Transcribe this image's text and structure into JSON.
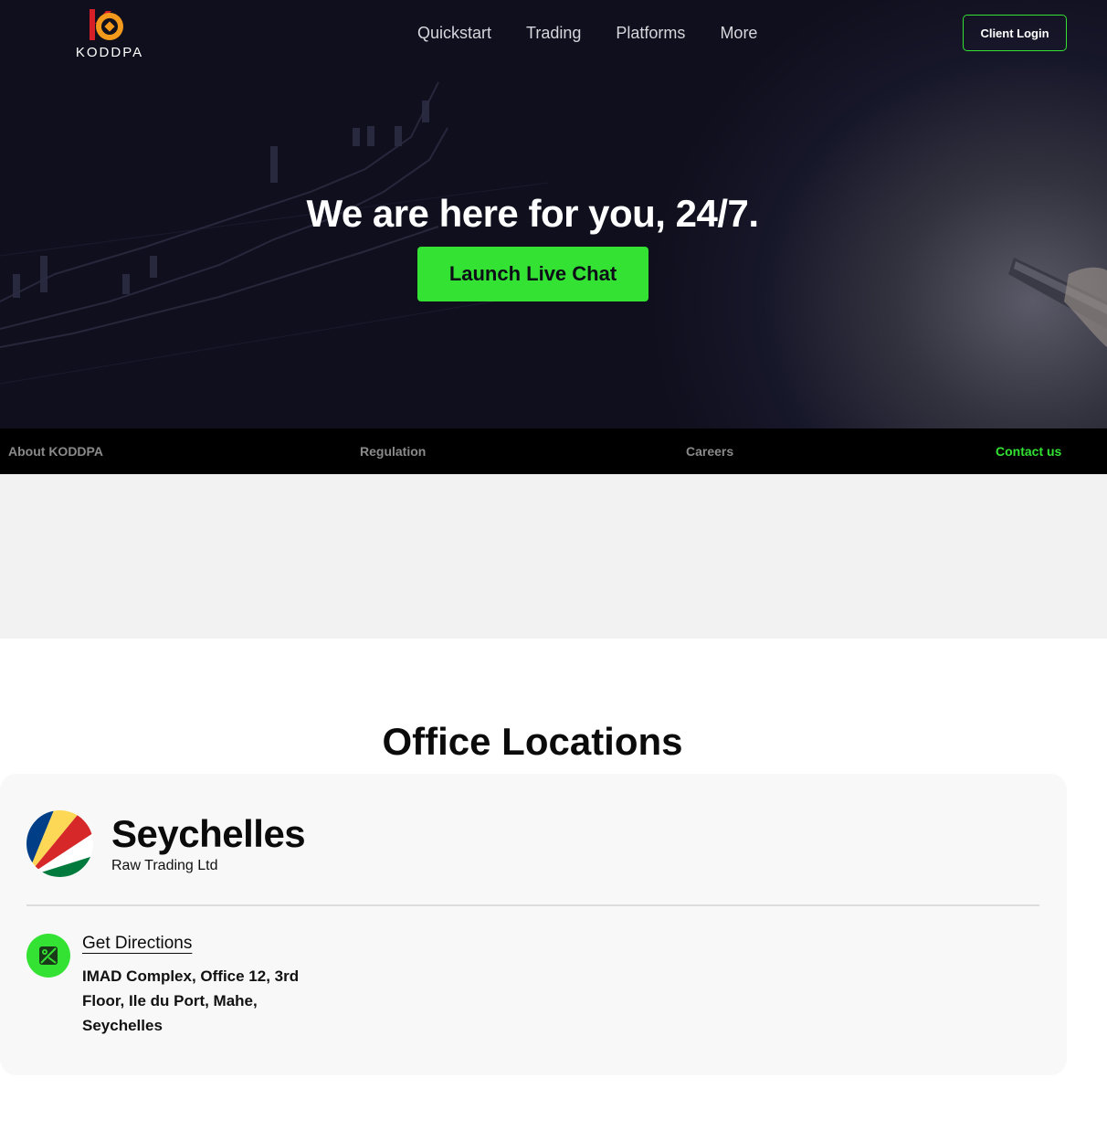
{
  "header": {
    "logo_text": "KODDPA",
    "nav": [
      "Quickstart",
      "Trading",
      "Platforms",
      "More"
    ],
    "login_label": "Client Login"
  },
  "hero": {
    "title": "We are here for you, 24/7.",
    "cta_label": "Launch Live Chat"
  },
  "subnav": {
    "items": [
      "About KODDPA",
      "Regulation",
      "Careers",
      "Contact us"
    ],
    "active": "Contact us"
  },
  "offices": {
    "title": "Office Locations",
    "items": [
      {
        "country": "Seychelles",
        "company": "Raw Trading Ltd",
        "directions_label": "Get Directions",
        "address": "IMAD Complex, Office 12, 3rd Floor, Ile du Port, Mahe, Seychelles",
        "flag_icon": "seychelles-flag-icon",
        "map_icon": "map-pin-icon"
      }
    ]
  },
  "colors": {
    "accent": "#33e233",
    "hero_bg": "#111122",
    "subnav_bg": "#000000",
    "subnav_text": "#8a8a8a"
  }
}
